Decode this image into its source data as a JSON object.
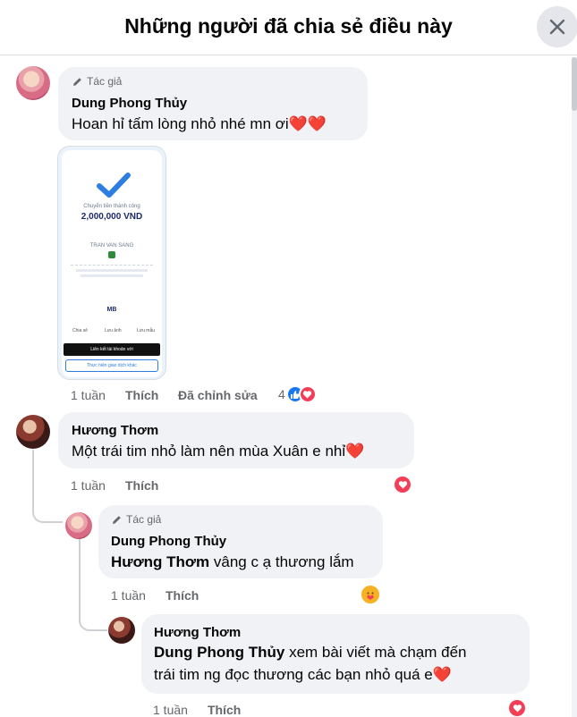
{
  "dialog": {
    "title": "Những người đã chia sẻ điều này",
    "close_icon": "close-icon"
  },
  "labels": {
    "author_badge": "Tác giả",
    "like": "Thích",
    "edited": "Đã chỉnh sửa"
  },
  "comments": [
    {
      "name": "Dung Phong Thủy",
      "is_author": true,
      "text": "Hoan hỉ tấm lòng nhỏ nhé mn ơi❤️❤️",
      "time": "1 tuần",
      "edited": true,
      "reaction_count": "4",
      "reactions": [
        "like",
        "love"
      ],
      "attachment": {
        "title": "Chuyển tiền thành công",
        "amount": "2,000,000 VND",
        "recipient": "TRAN VAN SANG",
        "bank": "MB",
        "actions": [
          "Chia sẻ",
          "Lưu ảnh",
          "Lưu mẫu"
        ],
        "link_label": "Liên kết tài khoản với",
        "cta": "Thực hiện giao dịch khác"
      }
    },
    {
      "name": "Hương Thơm",
      "is_author": false,
      "text": "Một trái tim nhỏ làm nên mùa Xuân e nhỉ❤️",
      "time": "1 tuần",
      "reactions": [
        "love"
      ]
    },
    {
      "name": "Dung Phong Thủy",
      "is_author": true,
      "mention": "Hương Thơm",
      "text": " vâng c ạ thương lắm",
      "time": "1 tuần",
      "reactions": [
        "care"
      ]
    },
    {
      "name": "Hương Thơm",
      "is_author": false,
      "mention": "Dung Phong Thủy",
      "text_line1": " xem bài viết mà chạm đến",
      "text_line2": "trái tim ng đọc thương các bạn nhỏ quá e❤️",
      "time": "1 tuần",
      "reactions": [
        "love"
      ]
    }
  ],
  "colors": {
    "bubble": "#f0f2f5",
    "meta_text": "#65676b",
    "like_blue": "#1877f2",
    "love_red": "#f33e58",
    "care_yellow": "#f7b125"
  }
}
